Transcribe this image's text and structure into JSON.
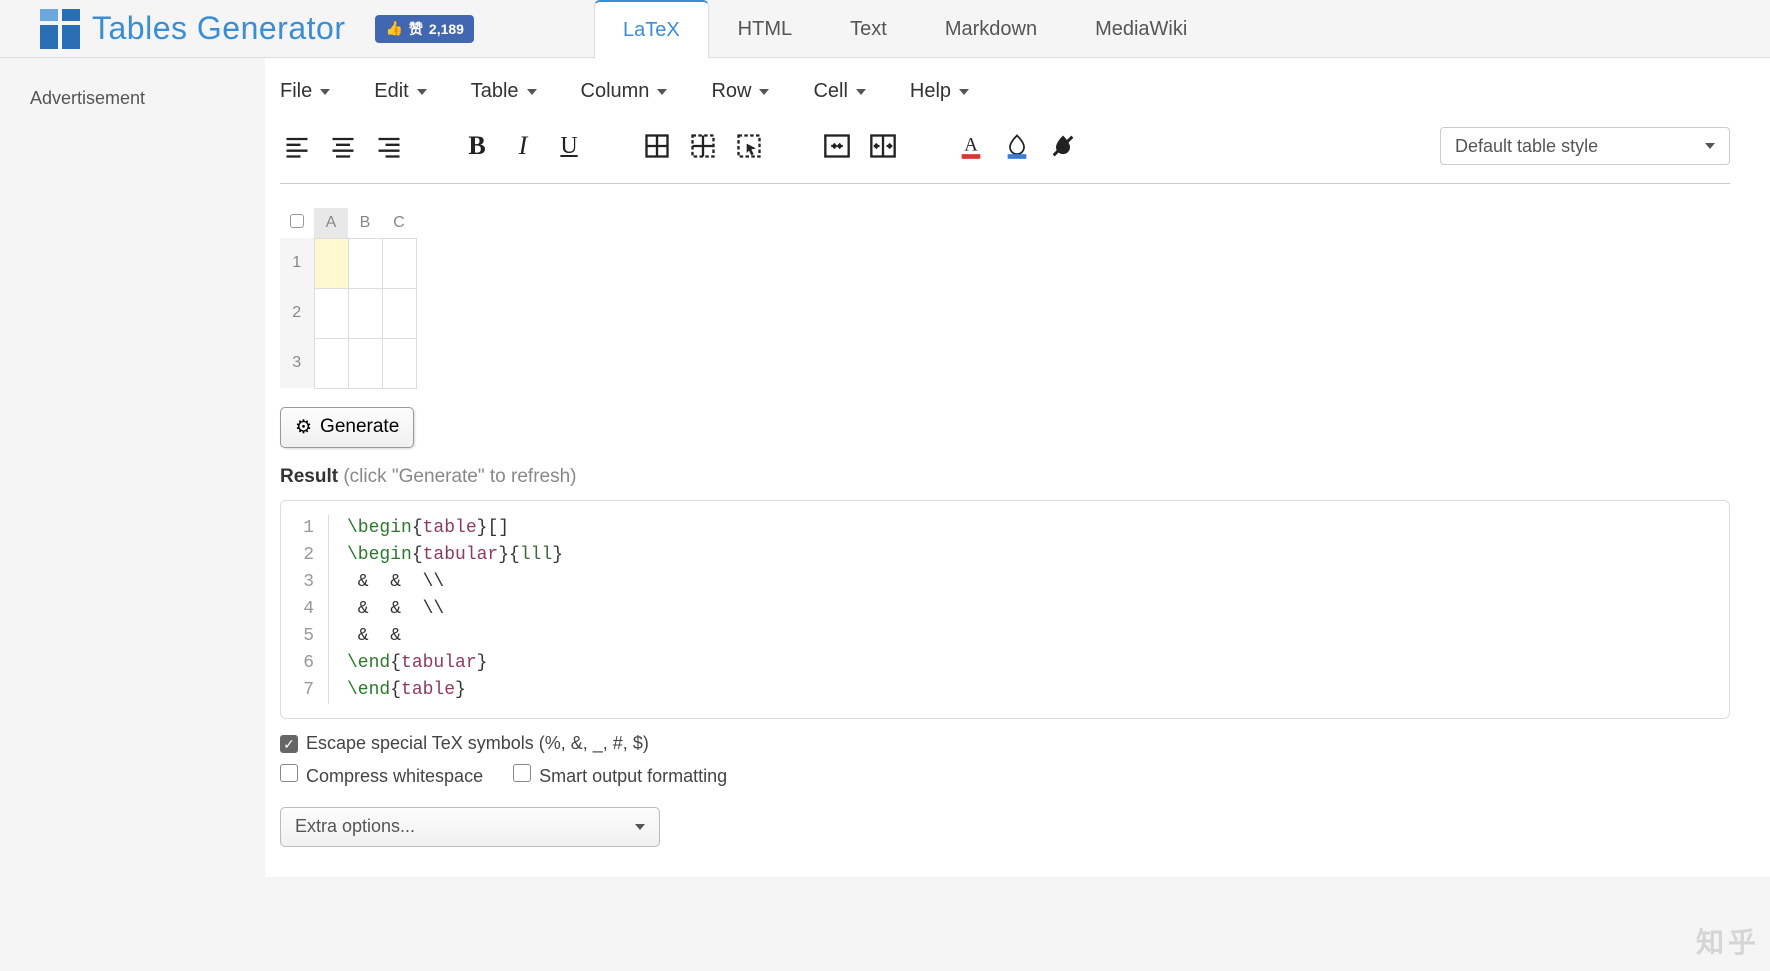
{
  "header": {
    "site_title": "Tables Generator",
    "fb_like_label": "赞",
    "fb_like_count": "2,189"
  },
  "tabs": [
    "LaTeX",
    "HTML",
    "Text",
    "Markdown",
    "MediaWiki"
  ],
  "active_tab": "LaTeX",
  "sidebar": {
    "ad_label": "Advertisement"
  },
  "menu": [
    "File",
    "Edit",
    "Table",
    "Column",
    "Row",
    "Cell",
    "Help"
  ],
  "style_dropdown": "Default table style",
  "sheet": {
    "columns": [
      "A",
      "B",
      "C"
    ],
    "rows": [
      "1",
      "2",
      "3"
    ],
    "selected_col": "A",
    "selected_row": "1"
  },
  "generate_label": "Generate",
  "result": {
    "label": "Result",
    "hint": "(click \"Generate\" to refresh)"
  },
  "code_lines": [
    [
      {
        "t": "cmd",
        "v": "\\begin"
      },
      {
        "t": "txt",
        "v": "{"
      },
      {
        "t": "env",
        "v": "table"
      },
      {
        "t": "txt",
        "v": "}[]"
      }
    ],
    [
      {
        "t": "cmd",
        "v": "\\begin"
      },
      {
        "t": "txt",
        "v": "{"
      },
      {
        "t": "env",
        "v": "tabular"
      },
      {
        "t": "txt",
        "v": "}{"
      },
      {
        "t": "arg",
        "v": "lll"
      },
      {
        "t": "txt",
        "v": "}"
      }
    ],
    [
      {
        "t": "txt",
        "v": " &  &  \\\\"
      }
    ],
    [
      {
        "t": "txt",
        "v": " &  &  \\\\"
      }
    ],
    [
      {
        "t": "txt",
        "v": " &  & "
      }
    ],
    [
      {
        "t": "cmd",
        "v": "\\end"
      },
      {
        "t": "txt",
        "v": "{"
      },
      {
        "t": "env",
        "v": "tabular"
      },
      {
        "t": "txt",
        "v": "}"
      }
    ],
    [
      {
        "t": "cmd",
        "v": "\\end"
      },
      {
        "t": "txt",
        "v": "{"
      },
      {
        "t": "env",
        "v": "table"
      },
      {
        "t": "txt",
        "v": "}"
      }
    ]
  ],
  "options": {
    "escape": {
      "label": "Escape special TeX symbols (%, &, _, #, $)",
      "checked": true
    },
    "compress": {
      "label": "Compress whitespace",
      "checked": false
    },
    "smart": {
      "label": "Smart output formatting",
      "checked": false
    },
    "extra": "Extra options..."
  },
  "watermark": "知乎"
}
